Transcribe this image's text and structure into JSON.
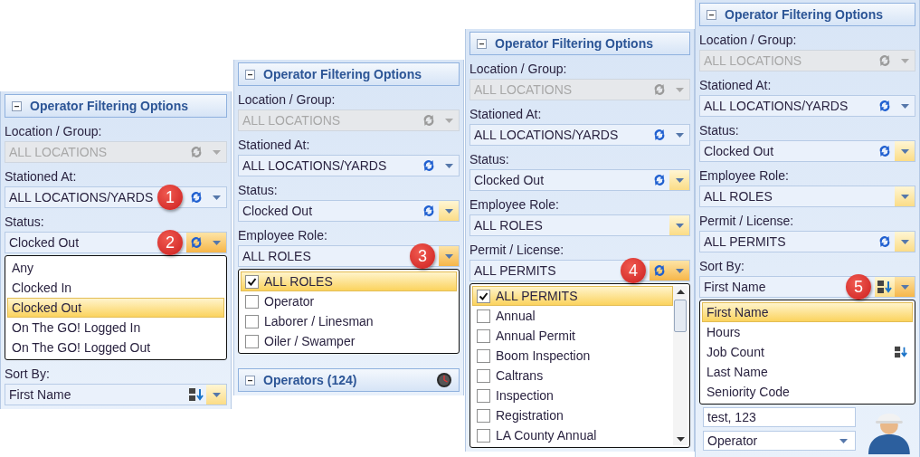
{
  "panels": [
    {
      "header": "Operator Filtering Options",
      "fields": [
        {
          "label": "Location / Group:",
          "value": "ALL LOCATIONS",
          "kind": "refresh-combo",
          "disabled": true,
          "open": false,
          "highlighted": false
        },
        {
          "label": "Stationed At:",
          "value": "ALL LOCATIONS/YARDS",
          "kind": "refresh-combo",
          "disabled": false,
          "open": false,
          "highlighted": false,
          "badge": "1"
        },
        {
          "label": "Status:",
          "value": "Clocked Out",
          "kind": "refresh-combo",
          "disabled": false,
          "open": true,
          "highlighted": true,
          "badge": "2",
          "popup": {
            "kind": "list",
            "scrollable": false,
            "items": [
              {
                "label": "Any",
                "selected": false
              },
              {
                "label": "Clocked In",
                "selected": false
              },
              {
                "label": "Clocked Out",
                "selected": true
              },
              {
                "label": "On The GO! Logged In",
                "selected": false
              },
              {
                "label": "On The GO! Logged Out",
                "selected": false
              }
            ]
          }
        },
        {
          "label": "Sort By:",
          "value": "First Name",
          "kind": "sort-combo",
          "disabled": false,
          "open": false,
          "highlighted": true
        }
      ]
    },
    {
      "header": "Operator Filtering Options",
      "fields": [
        {
          "label": "Location / Group:",
          "value": "ALL LOCATIONS",
          "kind": "refresh-combo",
          "disabled": true,
          "open": false,
          "highlighted": false
        },
        {
          "label": "Stationed At:",
          "value": "ALL LOCATIONS/YARDS",
          "kind": "refresh-combo",
          "disabled": false,
          "open": false,
          "highlighted": false
        },
        {
          "label": "Status:",
          "value": "Clocked Out",
          "kind": "refresh-combo",
          "disabled": false,
          "open": false,
          "highlighted": true
        },
        {
          "label": "Employee Role:",
          "value": "ALL ROLES",
          "kind": "combo",
          "disabled": false,
          "open": true,
          "highlighted": true,
          "badge": "3",
          "popup": {
            "kind": "checklist",
            "scrollable": false,
            "items": [
              {
                "label": "ALL ROLES",
                "selected": true,
                "checked": true
              },
              {
                "label": "Operator",
                "selected": false,
                "checked": false
              },
              {
                "label": "Laborer / Linesman",
                "selected": false,
                "checked": false
              },
              {
                "label": "Oiler / Swamper",
                "selected": false,
                "checked": false
              }
            ]
          }
        }
      ],
      "section": "Operators (124)"
    },
    {
      "header": "Operator Filtering Options",
      "fields": [
        {
          "label": "Location / Group:",
          "value": "ALL LOCATIONS",
          "kind": "refresh-combo",
          "disabled": true,
          "open": false,
          "highlighted": false
        },
        {
          "label": "Stationed At:",
          "value": "ALL LOCATIONS/YARDS",
          "kind": "refresh-combo",
          "disabled": false,
          "open": false,
          "highlighted": false
        },
        {
          "label": "Status:",
          "value": "Clocked Out",
          "kind": "refresh-combo",
          "disabled": false,
          "open": false,
          "highlighted": true
        },
        {
          "label": "Employee Role:",
          "value": "ALL ROLES",
          "kind": "combo",
          "disabled": false,
          "open": false,
          "highlighted": true
        },
        {
          "label": "Permit / License:",
          "value": "ALL PERMITS",
          "kind": "refresh-combo",
          "disabled": false,
          "open": true,
          "highlighted": true,
          "badge": "4",
          "popup": {
            "kind": "checklist",
            "scrollable": true,
            "items": [
              {
                "label": "ALL PERMITS",
                "selected": true,
                "checked": true
              },
              {
                "label": "Annual",
                "selected": false,
                "checked": false
              },
              {
                "label": "Annual Permit",
                "selected": false,
                "checked": false
              },
              {
                "label": "Boom Inspection",
                "selected": false,
                "checked": false
              },
              {
                "label": "Caltrans",
                "selected": false,
                "checked": false
              },
              {
                "label": "Inspection",
                "selected": false,
                "checked": false
              },
              {
                "label": "Registration",
                "selected": false,
                "checked": false
              },
              {
                "label": "LA County Annual",
                "selected": false,
                "checked": false
              }
            ]
          }
        }
      ]
    },
    {
      "header": "Operator Filtering Options",
      "fields": [
        {
          "label": "Location / Group:",
          "value": "ALL LOCATIONS",
          "kind": "refresh-combo",
          "disabled": true,
          "open": false,
          "highlighted": false
        },
        {
          "label": "Stationed At:",
          "value": "ALL LOCATIONS/YARDS",
          "kind": "refresh-combo",
          "disabled": false,
          "open": false,
          "highlighted": false
        },
        {
          "label": "Status:",
          "value": "Clocked Out",
          "kind": "refresh-combo",
          "disabled": false,
          "open": false,
          "highlighted": true
        },
        {
          "label": "Employee Role:",
          "value": "ALL ROLES",
          "kind": "combo",
          "disabled": false,
          "open": false,
          "highlighted": true
        },
        {
          "label": "Permit / License:",
          "value": "ALL PERMITS",
          "kind": "refresh-combo",
          "disabled": false,
          "open": false,
          "highlighted": true
        },
        {
          "label": "Sort By:",
          "value": "First Name",
          "kind": "sort-combo",
          "disabled": false,
          "open": true,
          "highlighted": true,
          "badge": "5",
          "popup": {
            "kind": "list",
            "scrollable": false,
            "items": [
              {
                "label": "First Name",
                "selected": true,
                "sorted": false
              },
              {
                "label": "Hours",
                "selected": false,
                "sorted": false
              },
              {
                "label": "Job Count",
                "selected": false,
                "sorted": true
              },
              {
                "label": "Last Name",
                "selected": false,
                "sorted": false
              },
              {
                "label": "Seniority Code",
                "selected": false,
                "sorted": false
              }
            ]
          }
        }
      ],
      "card": {
        "name": "test, 123",
        "role": "Operator"
      }
    }
  ]
}
